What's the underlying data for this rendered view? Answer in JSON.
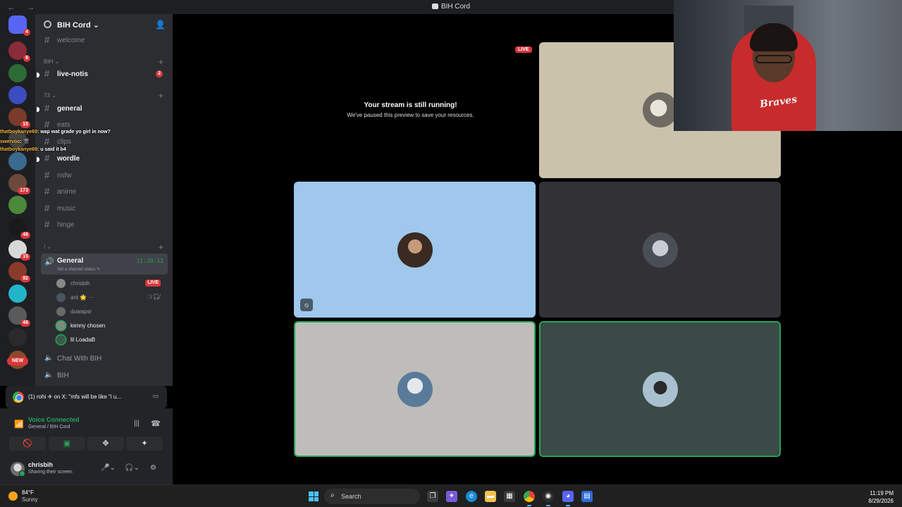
{
  "window": {
    "title": "BIH Cord"
  },
  "server": {
    "name": "BIH Cord"
  },
  "guilds": [
    {
      "badge": "4",
      "color": "#5865f2"
    },
    {
      "badge": "8",
      "color": "#8a2c3a"
    },
    {
      "badge": "",
      "color": "#2d6b35"
    },
    {
      "badge": "",
      "color": "#3b4cc0"
    },
    {
      "badge": "15",
      "color": "#7a3b2a"
    },
    {
      "badge": "",
      "color": "#444"
    },
    {
      "badge": "",
      "color": "#3a6b8f"
    },
    {
      "badge": "173",
      "color": "#6b4a3a"
    },
    {
      "badge": "",
      "color": "#4a8a3a"
    },
    {
      "badge": "48",
      "color": "#1a1a1a"
    },
    {
      "badge": "15",
      "color": "#d8d8d8"
    },
    {
      "badge": "92",
      "color": "#8a3a2a"
    },
    {
      "badge": "",
      "color": "#22b5c9"
    },
    {
      "badge": "48",
      "color": "#5a5a5a"
    },
    {
      "badge": "",
      "color": "#2a2a2a"
    },
    {
      "badge": "",
      "color": "#8a4a2a"
    }
  ],
  "guild_new_label": "NEW",
  "sidebar": {
    "welcome": "welcome",
    "cat_bih": "BIH",
    "live_notis": "live-notis",
    "live_notis_count": "2",
    "cat_73": "73",
    "general": "general",
    "eats": "eats",
    "clips": "clips",
    "wordle": "wordle",
    "nsfw": "nsfw",
    "anime": "anime",
    "music": "music",
    "hinge": "hinge",
    "cat_slash": "/"
  },
  "overlay_chat": [
    {
      "name": "thatboykanye69",
      "text": ": wap wat grade yo girl in now?"
    },
    {
      "name": "swervoo",
      "text": ": 🎬"
    },
    {
      "name": "thatboykanye69",
      "text": ": u said it b4"
    }
  ],
  "voice_channel": {
    "name": "General",
    "timer": "11:20:11",
    "status": "Set a channel status",
    "users": [
      {
        "name": "chrisbih",
        "live": "LIVE"
      },
      {
        "name": "ant 🌟 ···",
        "live": ""
      },
      {
        "name": "duwapsr",
        "live": ""
      },
      {
        "name": "kenny chosen",
        "live": ""
      },
      {
        "name": "lil LoadaB",
        "live": ""
      }
    ],
    "other1": "Chat With BIH",
    "other2": "BIH"
  },
  "notif": {
    "text": "(1) rohi ✈︎ on X: \"mfs will be like \"i u..."
  },
  "voice_panel": {
    "status": "Voice Connected",
    "sub": "General / BIH Cord"
  },
  "user_panel": {
    "name": "chrisbih",
    "status": "Sharing their screen"
  },
  "stage": {
    "live_tag": "LIVE",
    "msg_title": "Your stream is still running!",
    "msg_sub": "We've paused this preview to save your resources."
  },
  "taskbar": {
    "temp": "84°F",
    "cond": "Sunny",
    "search": "Search",
    "time": "11:19 PM",
    "date": "8/29/2026"
  }
}
